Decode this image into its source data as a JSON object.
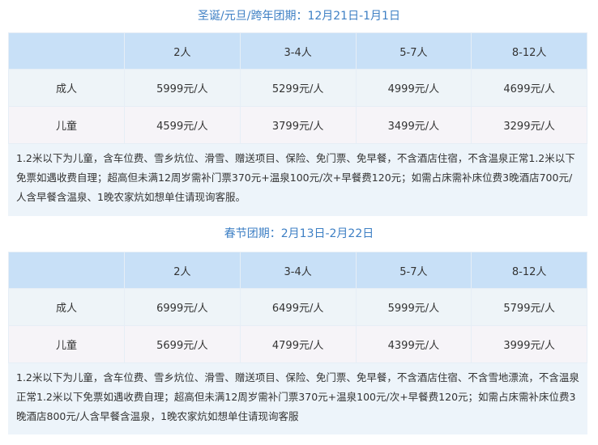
{
  "sections": [
    {
      "title": "圣诞/元旦/跨年团期：12月21日-1月1日",
      "headers": [
        "",
        "2人",
        "3-4人",
        "5-7人",
        "8-12人"
      ],
      "rows": [
        {
          "label": "成人",
          "values": [
            "5999元/人",
            "5299元/人",
            "4999元/人",
            "4699元/人"
          ]
        },
        {
          "label": "儿童",
          "values": [
            "4599元/人",
            "3799元/人",
            "3499元/人",
            "3299元/人"
          ]
        }
      ],
      "note": "1.2米以下为儿童，含车位费、雪乡炕位、滑雪、赠送项目、保险、免门票、免早餐，不含酒店住宿，不含温泉正常1.2米以下免票如遇收费自理；超高但未满12周岁需补门票370元+温泉100元/次+早餐费120元；如需占床需补床位费3晚酒店700元/人含早餐含温泉、1晚农家炕如想单住请现询客服。"
    },
    {
      "title": "春节团期：2月13日-2月22日",
      "headers": [
        "",
        "2人",
        "3-4人",
        "5-7人",
        "8-12人"
      ],
      "rows": [
        {
          "label": "成人",
          "values": [
            "6999元/人",
            "6499元/人",
            "5999元/人",
            "5799元/人"
          ]
        },
        {
          "label": "儿童",
          "values": [
            "5699元/人",
            "4799元/人",
            "4399元/人",
            "3999元/人"
          ]
        }
      ],
      "note": "1.2米以下为儿童，含车位费、雪乡炕位、滑雪、赠送项目、保险、免门票、免早餐，不含酒店住宿、不含雪地漂流，不含温泉正常1.2米以下免票如遇收费自理；超高但未满12周岁需补门票370元+温泉100元/次+早餐费120元；如需占床需补床位费3晚酒店800元/人含早餐含温泉，1晚农家炕如想单住请现询客服"
    }
  ]
}
